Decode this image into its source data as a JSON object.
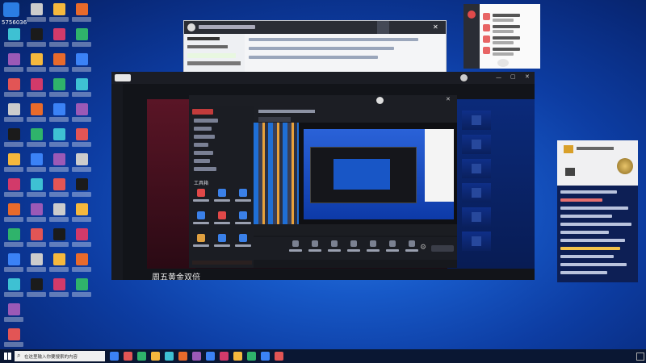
{
  "desktop": {
    "top_left_counter": "5756036",
    "icon_count": 70
  },
  "main_window": {
    "title": "",
    "caption": "周五黄金双倍"
  },
  "obs_window": {
    "logo_text": "",
    "left_menu_section": "工具箱"
  },
  "taskbar": {
    "search_placeholder": "在这里输入你要搜索的内容",
    "tray_app_label": "",
    "tray_ime": "",
    "time": "",
    "date": ""
  },
  "colors": {
    "app_dark": "#121419",
    "app_panel": "#1a1c22",
    "accent_red": "#d32a2a",
    "accent_blue": "#1f5bd0",
    "chat_card": "#0b1f63"
  }
}
